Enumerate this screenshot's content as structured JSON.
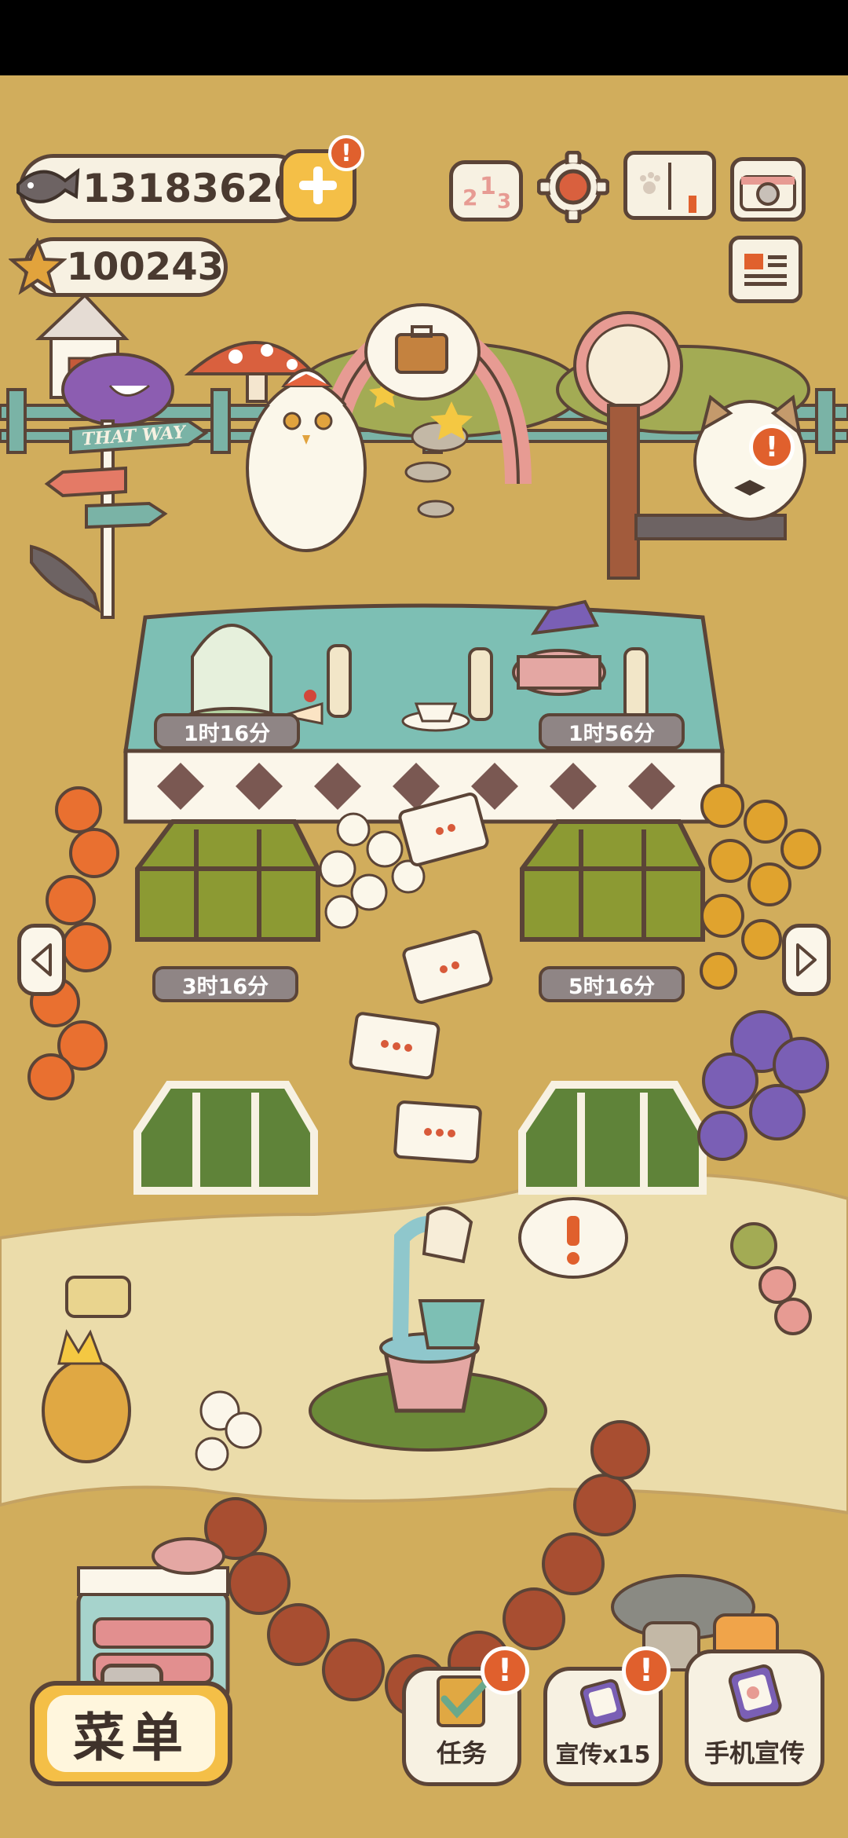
{
  "currency": {
    "fish_count": "13183620",
    "star_count": "100243"
  },
  "timers": {
    "table_left": "1时16分",
    "table_right": "1时56分",
    "greenhouse_top_left": "3时16分",
    "greenhouse_top_right": "5时16分"
  },
  "signpost": {
    "text": "THAT WAY"
  },
  "alerts": {
    "mark": "!"
  },
  "bottom_bar": {
    "menu_label": "菜单",
    "tasks_label": "任务",
    "promote_label": "宣传x15",
    "phone_promote_label": "手机宣传"
  },
  "icons": [
    "fish-icon",
    "plus-icon",
    "star-icon",
    "leaderboard-icon",
    "gear-icon",
    "paw-book-icon",
    "camera-icon",
    "newspaper-icon",
    "arrow-left-icon",
    "arrow-right-icon",
    "checklist-icon",
    "phone-icon"
  ],
  "colors": {
    "background": "#d1ad5c",
    "path": "#ebdcaa",
    "outline": "#5b4437",
    "badge": "#e0602d",
    "button_yellow": "#f4bf47",
    "timer": "#8f8585"
  }
}
